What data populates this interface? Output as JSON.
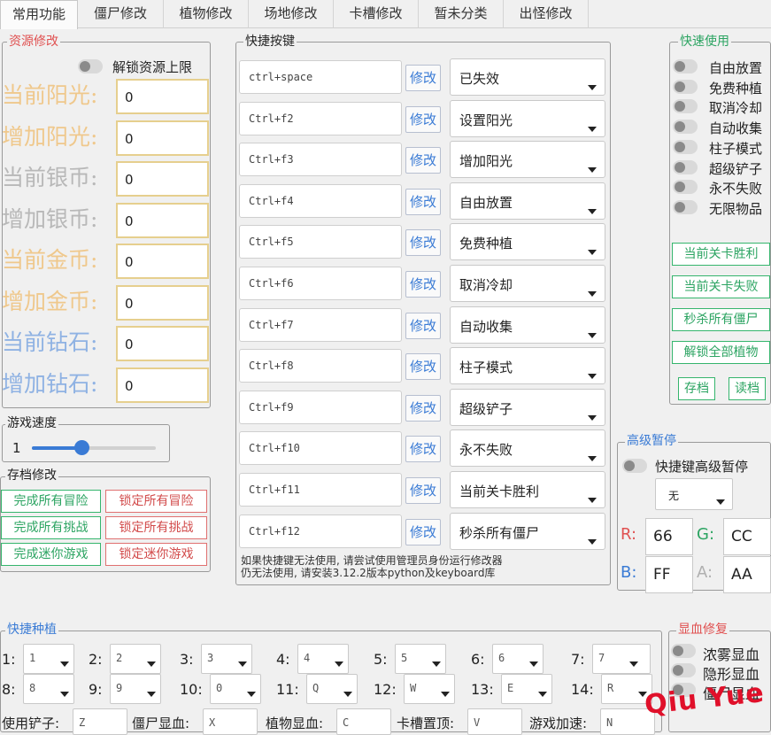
{
  "tabs": [
    "常用功能",
    "僵尸修改",
    "植物修改",
    "场地修改",
    "卡槽修改",
    "暂未分类",
    "出怪修改"
  ],
  "resource": {
    "title": "资源修改",
    "unlock_label": "解锁资源上限",
    "rows": [
      {
        "label": "当前阳光:",
        "value": "0",
        "color": "#efc88c"
      },
      {
        "label": "增加阳光:",
        "value": "0",
        "color": "#efc88c"
      },
      {
        "label": "当前银币:",
        "value": "0",
        "color": "#b8b8b8"
      },
      {
        "label": "增加银币:",
        "value": "0",
        "color": "#b8b8b8"
      },
      {
        "label": "当前金币:",
        "value": "0",
        "color": "#efc88c"
      },
      {
        "label": "增加金币:",
        "value": "0",
        "color": "#efc88c"
      },
      {
        "label": "当前钻石:",
        "value": "0",
        "color": "#8fb2e3"
      },
      {
        "label": "增加钻石:",
        "value": "0",
        "color": "#8fb2e3"
      }
    ]
  },
  "speed": {
    "title": "游戏速度",
    "value": "1"
  },
  "save": {
    "title": "存档修改",
    "rows": [
      {
        "left": "完成所有冒险",
        "right": "锁定所有冒险"
      },
      {
        "left": "完成所有挑战",
        "right": "锁定所有挑战"
      },
      {
        "left": "完成迷你游戏",
        "right": "锁定迷你游戏"
      }
    ]
  },
  "hotkeys": {
    "title": "快捷按键",
    "edit_label": "修改",
    "rows": [
      {
        "key": "ctrl+space",
        "action": "已失效"
      },
      {
        "key": "Ctrl+f2",
        "action": "设置阳光"
      },
      {
        "key": "Ctrl+f3",
        "action": "增加阳光"
      },
      {
        "key": "Ctrl+f4",
        "action": "自由放置"
      },
      {
        "key": "Ctrl+f5",
        "action": "免费种植"
      },
      {
        "key": "Ctrl+f6",
        "action": "取消冷却"
      },
      {
        "key": "Ctrl+f7",
        "action": "自动收集"
      },
      {
        "key": "Ctrl+f8",
        "action": "柱子模式"
      },
      {
        "key": "Ctrl+f9",
        "action": "超级铲子"
      },
      {
        "key": "Ctrl+f10",
        "action": "永不失败"
      },
      {
        "key": "Ctrl+f11",
        "action": "当前关卡胜利"
      },
      {
        "key": "Ctrl+f12",
        "action": "秒杀所有僵尸"
      }
    ],
    "note_line1": "如果快捷键无法使用, 请尝试使用管理员身份运行修改器",
    "note_line2": "仍无法使用, 请安装3.12.2版本python及keyboard库"
  },
  "quick": {
    "title": "快速使用",
    "toggles": [
      "自由放置",
      "免费种植",
      "取消冷却",
      "自动收集",
      "柱子模式",
      "超级铲子",
      "永不失败",
      "无限物品"
    ],
    "buttons": [
      "当前关卡胜利",
      "当前关卡失败",
      "秒杀所有僵尸",
      "解锁全部植物"
    ],
    "save_btn": "存档",
    "load_btn": "读档"
  },
  "pause": {
    "title": "高级暂停",
    "toggle_label": "快捷键高级暂停",
    "combo_value": "无",
    "colors": [
      {
        "label": "R:",
        "value": "66"
      },
      {
        "label": "G:",
        "value": "CC"
      },
      {
        "label": "B:",
        "value": "FF"
      },
      {
        "label": "A:",
        "value": "AA"
      }
    ]
  },
  "planting": {
    "title": "快捷种植",
    "slots": [
      {
        "label": "1:",
        "value": "1"
      },
      {
        "label": "2:",
        "value": "2"
      },
      {
        "label": "3:",
        "value": "3"
      },
      {
        "label": "4:",
        "value": "4"
      },
      {
        "label": "5:",
        "value": "5"
      },
      {
        "label": "6:",
        "value": "6"
      },
      {
        "label": "7:",
        "value": "7"
      },
      {
        "label": "8:",
        "value": "8"
      },
      {
        "label": "9:",
        "value": "9"
      },
      {
        "label": "10:",
        "value": "0"
      },
      {
        "label": "11:",
        "value": "Q"
      },
      {
        "label": "12:",
        "value": "W"
      },
      {
        "label": "13:",
        "value": "E"
      },
      {
        "label": "14:",
        "value": "R"
      }
    ],
    "bottom": [
      {
        "label": "使用铲子:",
        "value": "Z"
      },
      {
        "label": "僵尸显血:",
        "value": "X"
      },
      {
        "label": "植物显血:",
        "value": "C"
      },
      {
        "label": "卡槽置顶:",
        "value": "V"
      },
      {
        "label": "游戏加速:",
        "value": "N"
      }
    ]
  },
  "hp": {
    "title": "显血修复",
    "toggles": [
      "浓雾显血",
      "隐形显血",
      "僵尸显血"
    ]
  },
  "watermark": "Qiu Yue",
  "colors": {
    "accent_blue": "#3a7bd5",
    "green": "#2ca462",
    "red": "#d24b4b",
    "title_red": "#e05050"
  }
}
